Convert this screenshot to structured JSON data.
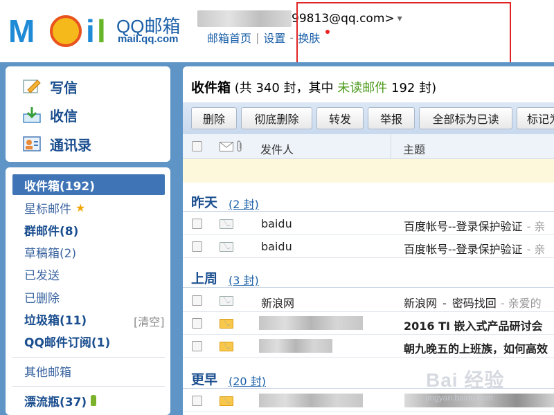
{
  "header": {
    "logo": {
      "letters_m": "M",
      "letters_i": "i",
      "letters_l": "l",
      "brand": "QQ邮箱",
      "domain": "mail.qq.com"
    },
    "account": {
      "email_suffix": "99813@qq.com>",
      "caret": "▾"
    },
    "links": [
      {
        "label": "邮箱首页"
      },
      {
        "label": "设置"
      },
      {
        "label": "换肤"
      }
    ],
    "link_separator": "|",
    "link_separator2": "-"
  },
  "quick_actions": [
    {
      "label": "写信",
      "icon": "compose-icon"
    },
    {
      "label": "收信",
      "icon": "receive-icon"
    },
    {
      "label": "通讯录",
      "icon": "contacts-icon"
    }
  ],
  "folders": {
    "inbox": "收件箱(192)",
    "starred": "星标邮件",
    "group": "群邮件(8)",
    "drafts": "草稿箱(2)",
    "sent": "已发送",
    "deleted": "已删除",
    "spam": "垃圾箱(11)",
    "spam_clear": "[清空]",
    "subscription": "QQ邮件订阅(1)",
    "other": "其他邮箱",
    "drift": "漂流瓶(37)"
  },
  "main": {
    "title": "收件箱",
    "summary_prefix": " (共 340 封，其中 ",
    "summary_unread": "未读邮件",
    "summary_suffix": " 192 封)",
    "toolbar": [
      "删除",
      "彻底删除",
      "转发",
      "举报",
      "全部标为已读",
      "标记为"
    ],
    "columns": {
      "sender": "发件人",
      "subject": "主题"
    },
    "groups": [
      {
        "title": "昨天",
        "count": "(2 封)"
      },
      {
        "title": "上周",
        "count": "(3 封)"
      },
      {
        "title": "更早",
        "count": "(20 封)"
      }
    ],
    "rows": [
      {
        "sender": "baidu",
        "subject": "百度帐号--登录保护验证",
        "preview": "-  亲"
      },
      {
        "sender": "baidu",
        "subject": "百度帐号--登录保护验证",
        "preview": "-  亲"
      },
      {
        "sender": "新浪网",
        "subject_a": "新浪网",
        "subject_b": "密码找回",
        "preview": "-  亲爱的"
      },
      {
        "sender": "",
        "subject": "2016 TI 嵌入式产品研讨会"
      },
      {
        "sender": "",
        "subject": "朝九晚五的上班族，如何高效"
      },
      {
        "sender": "",
        "subject": ""
      }
    ]
  },
  "watermark": {
    "line1": "Bai 经验",
    "line2": "jingyan.baidu.com"
  },
  "colors": {
    "frame_blue": "#5e94c6",
    "link_blue": "#1a5fa8",
    "unread_green": "#4a9a1a",
    "highlight_red": "#e02424"
  }
}
